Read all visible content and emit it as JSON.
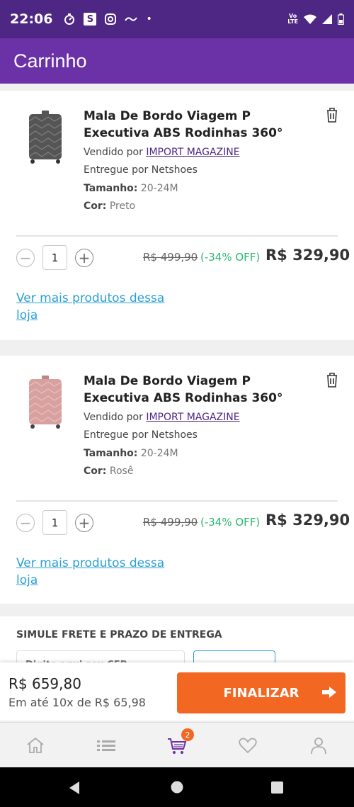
{
  "status_bar": {
    "time": "22:06",
    "s_badge": "S",
    "volte_top": "Vo",
    "volte_bottom": "LTE"
  },
  "app_bar": {
    "title": "Carrinho"
  },
  "items": [
    {
      "title": "Mala De Bordo Viagem P Executiva ABS Rodinhas 360°",
      "sold_by_prefix": "Vendido por ",
      "seller": "IMPORT MAGAZINE",
      "delivered_by": "Entregue por Netshoes",
      "size_label": "Tamanho:",
      "size_value": "20-24M",
      "color_label": "Cor:",
      "color_value": "Preto",
      "quantity": "1",
      "old_price": "R$ 499,90",
      "discount": "(-34% OFF)",
      "price": "R$ 329,90",
      "more_link": "Ver mais produtos dessa loja",
      "suitcase_color": "#555555"
    },
    {
      "title": "Mala De Bordo Viagem P Executiva ABS Rodinhas 360°",
      "sold_by_prefix": "Vendido por ",
      "seller": "IMPORT MAGAZINE",
      "delivered_by": "Entregue por Netshoes",
      "size_label": "Tamanho:",
      "size_value": "20-24M",
      "color_label": "Cor:",
      "color_value": "Rosê",
      "quantity": "1",
      "old_price": "R$ 499,90",
      "discount": "(-34% OFF)",
      "price": "R$ 329,90",
      "more_link": "Ver mais produtos dessa loja",
      "suitcase_color": "#d9a0a0"
    }
  ],
  "shipping": {
    "title": "SIMULE FRETE E PRAZO DE ENTREGA",
    "placeholder": "Digite aqui seu CEP"
  },
  "footer": {
    "total": "R$ 659,80",
    "installments": "Em até 10x de R$ 65,98",
    "checkout_label": "FINALIZAR"
  },
  "bottom_nav": {
    "cart_badge": "2",
    "icons": [
      "home-icon",
      "list-icon",
      "cart-icon",
      "heart-icon",
      "user-icon"
    ]
  },
  "colors": {
    "brand_dark": "#4e2683",
    "brand": "#6b31a6",
    "accent": "#f26722",
    "discount": "#2bb673",
    "link": "#2a9fd6"
  }
}
